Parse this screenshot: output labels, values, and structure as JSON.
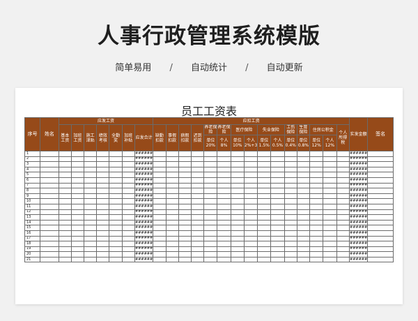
{
  "page": {
    "title": "人事行政管理系统模版",
    "features": [
      "简单易用",
      "自动统计",
      "自动更新"
    ],
    "separator": "/"
  },
  "sheet": {
    "title": "员工工资表",
    "headers": {
      "seq": "序号",
      "name": "姓名",
      "payable_group": "应发工资",
      "deduction_group": "应扣工资",
      "net": "实发金额",
      "sign": "签名",
      "payable": [
        "基本工资",
        "加班工资",
        "施工津贴",
        "绩效考核",
        "全勤奖",
        "加班补贴",
        "应发合计"
      ],
      "deductions_simple": [
        "缺勤扣款",
        "事假扣款",
        "病假扣款",
        "迟到扣款"
      ],
      "pension": "养老保险",
      "medical": "医疗保险",
      "unemployment": "失业保险",
      "injury": "工伤保险",
      "maternity": "生育保险",
      "housing": "住房公积金",
      "personal_tax": "个人所得税",
      "unit": "单位",
      "personal": "个人",
      "rates": {
        "pension_unit": "20%",
        "pension_personal": "8%",
        "medical_unit": "10%",
        "medical_personal": "2%+3",
        "unemployment_unit": "1.5%",
        "unemployment_personal": "0.5%",
        "injury_unit": "0.4%",
        "maternity_unit": "0.8%",
        "housing_unit": "12%",
        "housing_personal": "12%"
      }
    },
    "placeholder": "######",
    "rows": [
      "1",
      "2",
      "3",
      "4",
      "5",
      "6",
      "7",
      "8",
      "9",
      "10",
      "11",
      "12",
      "13",
      "14",
      "15",
      "16",
      "17",
      "18",
      "19",
      "20",
      "21"
    ]
  }
}
